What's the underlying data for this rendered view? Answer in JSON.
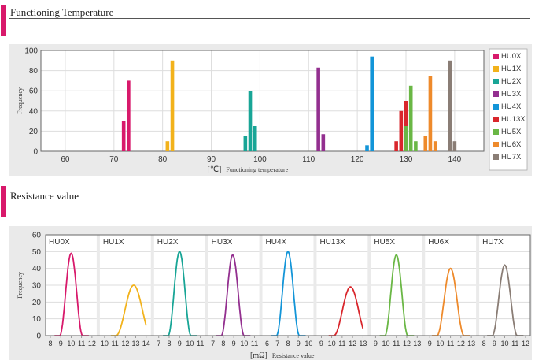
{
  "sections": {
    "temperature_title": "Functioning Temperature",
    "resistance_title": "Resistance value"
  },
  "colors": {
    "accent": "#d8196b",
    "HU0X": "#d8196b",
    "HU1X": "#f2b21b",
    "HU2X": "#18a596",
    "HU3X": "#932f8f",
    "HU4X": "#1395d8",
    "HU13X": "#d9262c",
    "HU5X": "#6ab745",
    "HU6X": "#ee8a2b",
    "HU7X": "#8a7d75"
  },
  "chart_data": [
    {
      "type": "bar",
      "title": "",
      "xlabel_unit": "[℃]",
      "xlabel": "Functioning temperature",
      "ylabel": "Frequency",
      "xlim": [
        55,
        146
      ],
      "ylim": [
        0,
        100
      ],
      "xticks": [
        60,
        70,
        80,
        90,
        100,
        110,
        120,
        130,
        140
      ],
      "yticks": [
        0,
        20,
        40,
        60,
        80,
        100
      ],
      "legend_position": "right",
      "legend": [
        "HU0X",
        "HU1X",
        "HU2X",
        "HU3X",
        "HU4X",
        "HU13X",
        "HU5X",
        "HU6X",
        "HU7X"
      ],
      "series": [
        {
          "name": "HU0X",
          "points": [
            [
              72,
              30
            ],
            [
              73,
              70
            ]
          ]
        },
        {
          "name": "HU1X",
          "points": [
            [
              81,
              10
            ],
            [
              82,
              90
            ]
          ]
        },
        {
          "name": "HU2X",
          "points": [
            [
              97,
              15
            ],
            [
              98,
              60
            ],
            [
              99,
              25
            ]
          ]
        },
        {
          "name": "HU3X",
          "points": [
            [
              112,
              83
            ],
            [
              113,
              17
            ]
          ]
        },
        {
          "name": "HU4X",
          "points": [
            [
              122,
              6
            ],
            [
              123,
              94
            ]
          ]
        },
        {
          "name": "HU13X",
          "points": [
            [
              128,
              10
            ],
            [
              129,
              40
            ],
            [
              130,
              50
            ]
          ]
        },
        {
          "name": "HU5X",
          "points": [
            [
              130,
              25
            ],
            [
              131,
              65
            ],
            [
              132,
              10
            ]
          ]
        },
        {
          "name": "HU6X",
          "points": [
            [
              134,
              15
            ],
            [
              135,
              75
            ],
            [
              136,
              10
            ]
          ]
        },
        {
          "name": "HU7X",
          "points": [
            [
              139,
              90
            ],
            [
              140,
              10
            ]
          ]
        }
      ]
    },
    {
      "type": "line",
      "title": "",
      "xlabel_unit": "[mΩ]",
      "xlabel": "Resistance value",
      "ylabel": "Frequency",
      "ylim": [
        0,
        60
      ],
      "yticks": [
        0,
        10,
        20,
        30,
        40,
        50,
        60
      ],
      "panels": [
        {
          "name": "HU0X",
          "xticks": [
            8,
            9,
            10,
            11,
            12
          ],
          "xlim": [
            8,
            12
          ],
          "peak": 10,
          "height": 49,
          "halfwidth": 1.1
        },
        {
          "name": "HU1X",
          "xticks": [
            10,
            11,
            12,
            13,
            14
          ],
          "xlim": [
            10,
            14
          ],
          "peak": 12.8,
          "height": 30,
          "halfwidth": 1.7
        },
        {
          "name": "HU2X",
          "xticks": [
            7,
            8,
            9,
            10,
            11
          ],
          "xlim": [
            7,
            11
          ],
          "peak": 9,
          "height": 50,
          "halfwidth": 1.1
        },
        {
          "name": "HU3X",
          "xticks": [
            7,
            8,
            9,
            10,
            11
          ],
          "xlim": [
            7,
            11
          ],
          "peak": 8.9,
          "height": 48,
          "halfwidth": 1.1
        },
        {
          "name": "HU4X",
          "xticks": [
            6,
            7,
            8,
            9,
            10
          ],
          "xlim": [
            6,
            10
          ],
          "peak": 8,
          "height": 50,
          "halfwidth": 1.1
        },
        {
          "name": "HU13X",
          "xticks": [
            9,
            10,
            11,
            12,
            13
          ],
          "xlim": [
            9,
            13
          ],
          "peak": 11.8,
          "height": 29,
          "halfwidth": 1.6
        },
        {
          "name": "HU5X",
          "xticks": [
            9,
            10,
            11,
            12,
            13
          ],
          "xlim": [
            9,
            13
          ],
          "peak": 11,
          "height": 48,
          "halfwidth": 1.1
        },
        {
          "name": "HU6X",
          "xticks": [
            9,
            10,
            11,
            12,
            13
          ],
          "xlim": [
            9,
            13
          ],
          "peak": 11,
          "height": 40,
          "halfwidth": 1.3
        },
        {
          "name": "HU7X",
          "xticks": [
            8,
            9,
            10,
            11,
            12
          ],
          "xlim": [
            8,
            12
          ],
          "peak": 10,
          "height": 42,
          "halfwidth": 1.2
        }
      ]
    }
  ]
}
